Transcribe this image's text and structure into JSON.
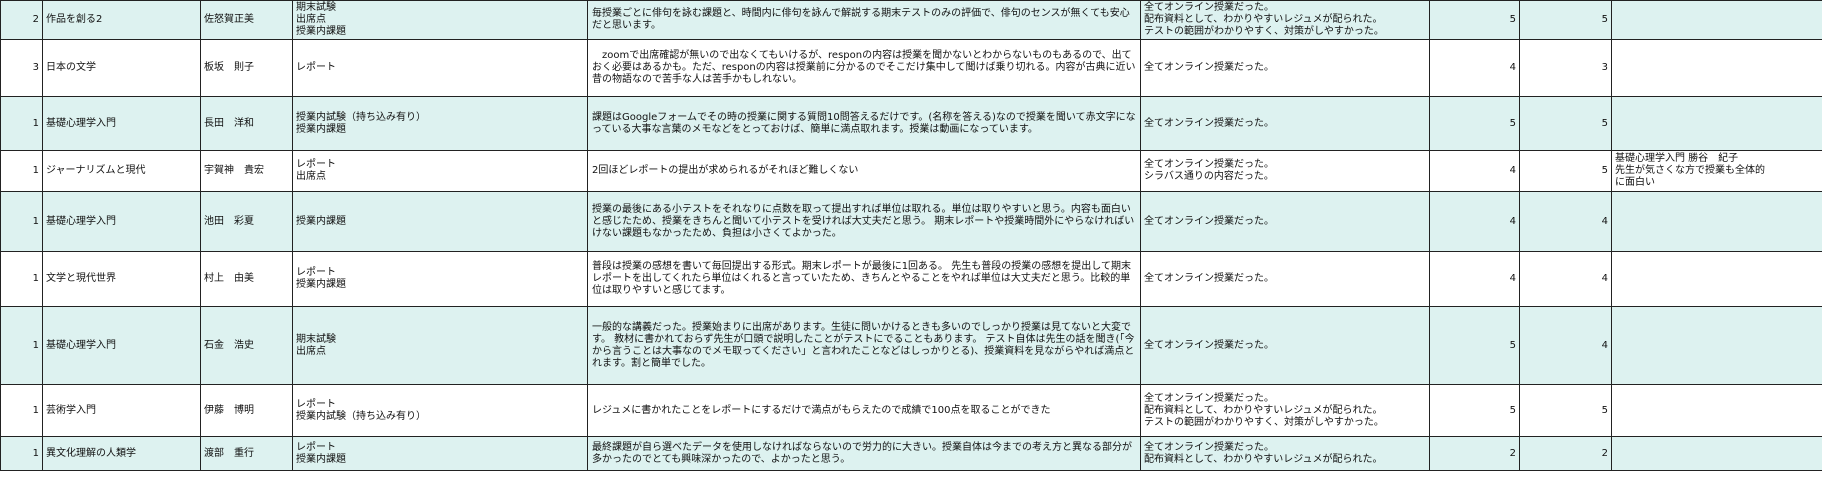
{
  "rows": [
    {
      "no": "2",
      "course": "作品を創る2",
      "teacher": "佐怒賀正美",
      "eval": [
        "期末試験",
        "出席点",
        "授業内課題"
      ],
      "comment": "毎授業ごとに俳句を詠む課題と、時間内に俳句を詠んで解説する期末テストのみの評価で、俳句のセンスが無くても安心だと思います。",
      "format": [
        "全てオンライン授業だった。",
        "配布資料として、わかりやすいレジュメが配られた。",
        "テストの範囲がわかりやすく、対策がしやすかった。"
      ],
      "score1": "5",
      "score2": "5",
      "extra": []
    },
    {
      "no": "3",
      "course": "日本の文学",
      "teacher": "板坂　則子",
      "eval": [
        "レポート"
      ],
      "comment": "　zoomで出席確認が無いので出なくてもいけるが、responの内容は授業を聞かないとわからないものもあるので、出ておく必要はあるかも。ただ、responの内容は授業前に分かるのでそこだけ集中して聞けば乗り切れる。内容が古典に近い昔の物語なので苦手な人は苦手かもしれない。",
      "format": [
        "全てオンライン授業だった。"
      ],
      "score1": "4",
      "score2": "3",
      "extra": []
    },
    {
      "no": "1",
      "course": "基礎心理学入門",
      "teacher": "長田　洋和",
      "eval": [
        "授業内試験（持ち込み有り）",
        "授業内課題"
      ],
      "comment": "課題はGoogleフォームでその時の授業に関する質問10問答えるだけです。(名称を答える)なので授業を聞いて赤文字になっている大事な言葉のメモなどをとっておけば、簡単に満点取れます。授業は動画になっています。",
      "format": [
        "全てオンライン授業だった。"
      ],
      "score1": "5",
      "score2": "5",
      "extra": []
    },
    {
      "no": "1",
      "course": "ジャーナリズムと現代",
      "teacher": "宇賀神　貴宏",
      "eval": [
        "レポート",
        "出席点"
      ],
      "comment": "2回ほどレポートの提出が求められるがそれほど難しくない",
      "format": [
        "全てオンライン授業だった。",
        "シラバス通りの内容だった。"
      ],
      "score1": "4",
      "score2": "5",
      "extra": [
        "基礎心理学入門 勝谷　紀子",
        "先生が気さくな方で授業も全体的",
        "に面白い"
      ]
    },
    {
      "no": "1",
      "course": "基礎心理学入門",
      "teacher": "池田　彩夏",
      "eval": [
        "授業内課題"
      ],
      "comment": "授業の最後にある小テストをそれなりに点数を取って提出すれば単位は取れる。単位は取りやすいと思う。内容も面白いと感じたため、授業をきちんと聞いて小テストを受ければ大丈夫だと思う。 期末レポートや授業時間外にやらなければいけない課題もなかったため、負担は小さくてよかった。",
      "format": [
        "全てオンライン授業だった。"
      ],
      "score1": "4",
      "score2": "4",
      "extra": []
    },
    {
      "no": "1",
      "course": "文学と現代世界",
      "teacher": "村上　由美",
      "eval": [
        "レポート",
        "授業内課題"
      ],
      "comment": "普段は授業の感想を書いて毎回提出する形式。期末レポートが最後に1回ある。 先生も普段の授業の感想を提出して期末レポートを出してくれたら単位はくれると言っていたため、きちんとやることをやれば単位は大丈夫だと思う。比較的単位は取りやすいと感じてます。",
      "format": [
        "全てオンライン授業だった。"
      ],
      "score1": "4",
      "score2": "4",
      "extra": []
    },
    {
      "no": "1",
      "course": "基礎心理学入門",
      "teacher": "石金　浩史",
      "eval": [
        "期末試験",
        "出席点"
      ],
      "comment": "一般的な講義だった。授業始まりに出席があります。生徒に問いかけるときも多いのでしっかり授業は見てないと大変です。 教材に書かれておらず先生が口頭で説明したことがテストにでることもあります。 テスト自体は先生の話を聞き(「今から言うことは大事なのでメモ取ってください」と言われたことなどはしっかりとる)、授業資料を見ながらやれば満点とれます。割と簡単でした。",
      "format": [
        "全てオンライン授業だった。"
      ],
      "score1": "5",
      "score2": "4",
      "extra": []
    },
    {
      "no": "1",
      "course": "芸術学入門",
      "teacher": "伊藤　博明",
      "eval": [
        "レポート",
        "授業内試験（持ち込み有り）"
      ],
      "comment": "レジュメに書かれたことをレポートにするだけで満点がもらえたので成績で100点を取ることができた",
      "format": [
        "全てオンライン授業だった。",
        "配布資料として、わかりやすいレジュメが配られた。",
        "テストの範囲がわかりやすく、対策がしやすかった。"
      ],
      "score1": "5",
      "score2": "5",
      "extra": []
    },
    {
      "no": "1",
      "course": "異文化理解の人類学",
      "teacher": "渡部　重行",
      "eval": [
        "レポート",
        "授業内課題"
      ],
      "comment": "最終課題が自ら選べたデータを使用しなければならないので労力的に大きい。授業自体は今までの考え方と異なる部分が多かったのでとても興味深かったので、よかったと思う。",
      "format": [
        "全てオンライン授業だった。",
        "配布資料として、わかりやすいレジュメが配られた。"
      ],
      "score1": "2",
      "score2": "2",
      "extra": []
    }
  ]
}
